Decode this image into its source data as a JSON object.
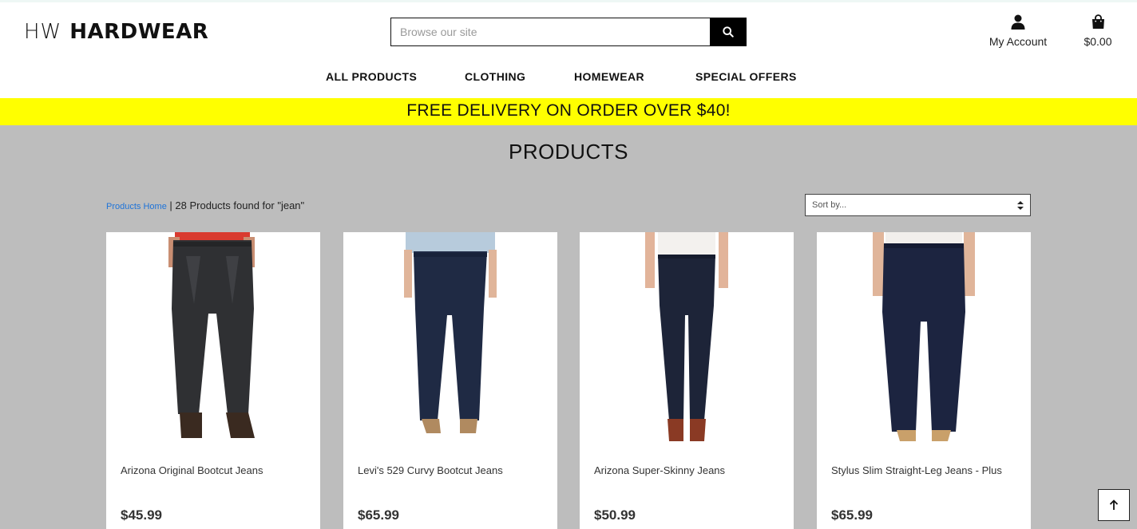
{
  "header": {
    "logo_prefix": "HW",
    "logo_name": "HARDWEAR",
    "search_placeholder": "Browse our site",
    "account_label": "My Account",
    "cart_total": "$0.00"
  },
  "nav": {
    "items": [
      {
        "label": "ALL PRODUCTS"
      },
      {
        "label": "CLOTHING"
      },
      {
        "label": "HOMEWEAR"
      },
      {
        "label": "SPECIAL OFFERS"
      }
    ]
  },
  "banner": {
    "text": "FREE DELIVERY ON ORDER OVER $40!"
  },
  "main": {
    "title": "PRODUCTS",
    "breadcrumb_link": "Products Home",
    "separator": " | ",
    "result_text": "28 Products found for \"jean\"",
    "sort_placeholder": "Sort by...",
    "products": [
      {
        "name": "Arizona Original Bootcut Jeans",
        "price": "$45.99"
      },
      {
        "name": "Levi's 529 Curvy Bootcut Jeans",
        "price": "$65.99"
      },
      {
        "name": "Arizona Super-Skinny Jeans",
        "price": "$50.99"
      },
      {
        "name": "Stylus Slim Straight-Leg Jeans - Plus",
        "price": "$65.99"
      }
    ]
  },
  "colors": {
    "banner": "#ffff00",
    "page_background": "#bdbdbd",
    "link": "#1e73d8"
  },
  "icons": {
    "search": "search-icon",
    "account": "user-icon",
    "cart": "shopping-bag-icon",
    "back_to_top": "arrow-up-icon",
    "sort": "sort-arrows-icon"
  }
}
